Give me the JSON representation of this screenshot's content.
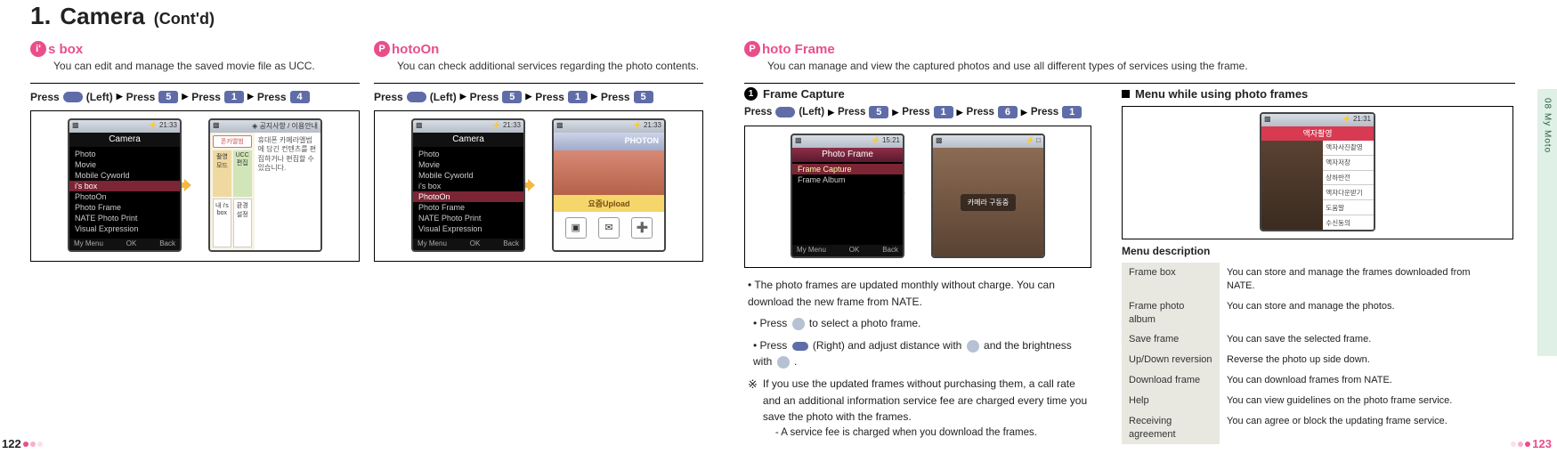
{
  "page": {
    "number": "1.",
    "title": "Camera",
    "cont": "(Cont'd)",
    "left_page": "122",
    "right_page": "123",
    "side_tab": "08  My Moto"
  },
  "isbox": {
    "letter": "i'",
    "rest": "s box",
    "desc": "You can edit and manage the saved movie file as UCC.",
    "press": {
      "w0": "Press",
      "w1": "(Left)",
      "w2": "Press",
      "k2": "5",
      "w3": "Press",
      "k3": "1",
      "w4": "Press",
      "k4": "4"
    },
    "screenA": {
      "status_left": "▩",
      "status_right": "⚡ 21:33",
      "title": "Camera",
      "items": [
        "Photo",
        "Movie",
        "Mobile Cyworld",
        "i's box",
        "PhotoOn",
        "Photo Frame",
        "NATE Photo Print",
        "Visual Expression"
      ],
      "sel_index": 3,
      "soft_left": "My Menu",
      "soft_mid": "OK",
      "soft_right": "Back"
    },
    "screenB": {
      "status_left": "▩",
      "status_right": "◈ 공지사항 / 이용안내",
      "body_text": "휴대폰 카메라앨범에 담긴 컨텐츠를 편집하거나 편집할 수 있습니다.",
      "tiles": [
        "촬영모드",
        "UCC편집",
        "내 i's box",
        "환경설정"
      ],
      "brand": "폰카앨범"
    }
  },
  "photoon": {
    "letter": "P",
    "rest": "hotoOn",
    "desc": "You can check additional services regarding the photo contents.",
    "press": {
      "w0": "Press",
      "w1": "(Left)",
      "w2": "Press",
      "k2": "5",
      "w3": "Press",
      "k3": "1",
      "w4": "Press",
      "k4": "5"
    },
    "screenA": {
      "status_left": "▩",
      "status_right": "⚡ 21:33",
      "title": "Camera",
      "items": [
        "Photo",
        "Movie",
        "Mobile Cyworld",
        "i's box",
        "PhotoOn",
        "Photo Frame",
        "NATE Photo Print",
        "Visual Expression"
      ],
      "sel_index": 4,
      "soft_left": "My Menu",
      "soft_mid": "OK",
      "soft_right": "Back"
    },
    "screenB": {
      "status_left": "▩",
      "status_right": "⚡ 21:33",
      "brand": "PHOTON",
      "upload": "요즘Upload",
      "buttons": [
        "▣",
        "✉",
        "➕"
      ]
    }
  },
  "photoframe": {
    "letter": "P",
    "rest": "hoto Frame",
    "desc": "You can manage and view the captured photos and use all different types of services using the frame.",
    "sub1": {
      "num": "1",
      "title": "Frame Capture",
      "press": {
        "w0": "Press",
        "w1": "(Left)",
        "w2": "Press",
        "k2": "5",
        "w3": "Press",
        "k3": "1",
        "w4": "Press",
        "k4": "6",
        "w5": "Press",
        "k5": "1"
      },
      "screenA": {
        "status_left": "▩",
        "status_right": "⚡ 15:21",
        "title": "Photo Frame",
        "items": [
          "Frame Capture",
          "Frame Album"
        ],
        "sel_index": 0,
        "soft_left": "My Menu",
        "soft_mid": "OK",
        "soft_right": "Back"
      },
      "screenB": {
        "status_left": "▩",
        "status_right": "⚡ □",
        "caption": "카메라 구동중"
      },
      "notes": {
        "n1": "The photo frames are updated monthly without charge. You can download the new frame from NATE.",
        "n2_pre": "Press",
        "n2_post": "to select a photo frame.",
        "n3_pre": "Press",
        "n3_mid": "(Right) and adjust distance with",
        "n3_mid2": "and the brightness with",
        "n3_end": ".",
        "n4_mark": "※",
        "n4": "If you use the updated frames without purchasing them, a call rate and an additional information service fee are charged every time you save the photo with the frames.",
        "n4b": "A service fee is charged when you download the frames."
      }
    },
    "sub2": {
      "title": "Menu while using photo frames",
      "screen": {
        "status_left": "▩",
        "status_right": "⚡ 21:31",
        "title": "액자촬영",
        "items": [
          "액자사진촬영",
          "액자저장",
          "상하반전",
          "액자다운받기",
          "도움말",
          "수신동의"
        ]
      },
      "desc_heading": "Menu description",
      "rows": [
        {
          "k": "Frame box",
          "v": "You can store and manage the frames downloaded from NATE."
        },
        {
          "k": "Frame photo album",
          "v": "You can store and manage the photos."
        },
        {
          "k": "Save frame",
          "v": "You can save the selected frame."
        },
        {
          "k": "Up/Down reversion",
          "v": "Reverse the photo up side down."
        },
        {
          "k": "Download frame",
          "v": "You can download frames from NATE."
        },
        {
          "k": "Help",
          "v": "You can view guidelines on the photo frame service."
        },
        {
          "k": "Receiving agreement",
          "v": "You can agree or block the updating frame service."
        }
      ]
    }
  }
}
